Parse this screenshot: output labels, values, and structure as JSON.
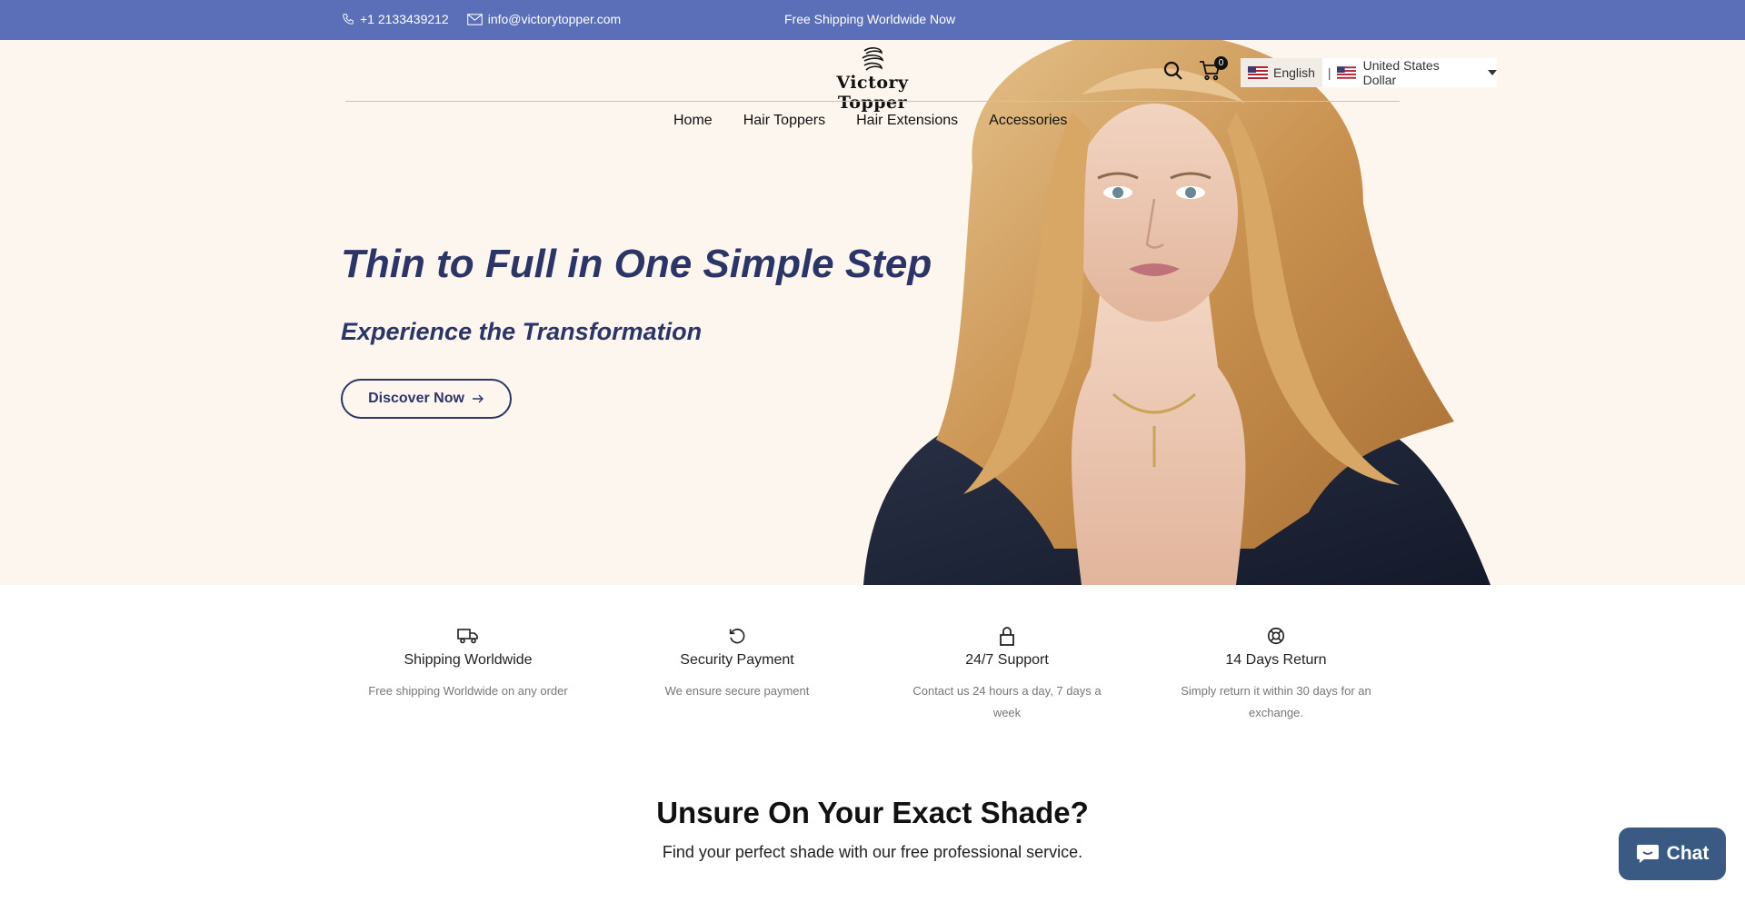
{
  "topbar": {
    "phone": "+1 2133439212",
    "email": "info@victorytopper.com",
    "promo": "Free Shipping Worldwide Now"
  },
  "header": {
    "logo_text": "Victory Topper",
    "cart_count": "0",
    "language": "English",
    "currency": "United States Dollar"
  },
  "nav": {
    "items": [
      {
        "label": "Home"
      },
      {
        "label": "Hair Toppers"
      },
      {
        "label": "Hair Extensions"
      },
      {
        "label": "Accessories"
      }
    ]
  },
  "hero": {
    "title": "Thin to Full in One Simple Step",
    "subtitle": "Experience the Transformation",
    "cta": "Discover Now"
  },
  "features": [
    {
      "icon": "truck-icon",
      "title": "Shipping Worldwide",
      "desc": "Free shipping Worldwide on any order"
    },
    {
      "icon": "refresh-icon",
      "title": "Security Payment",
      "desc": "We ensure secure payment"
    },
    {
      "icon": "lock-icon",
      "title": "24/7 Support",
      "desc": "Contact us 24 hours a day, 7 days a week"
    },
    {
      "icon": "lifebuoy-icon",
      "title": "14 Days Return",
      "desc": "Simply return it within 30 days for an exchange."
    }
  ],
  "shade": {
    "title": "Unsure On Your Exact Shade?",
    "subtitle": "Find your perfect shade with our free professional service."
  },
  "chat": {
    "label": "Chat"
  },
  "colors": {
    "topbar": "#5a6fb7",
    "hero_bg": "#fdf6ef",
    "accent_navy": "#2b3567",
    "chat": "#3a5a84"
  }
}
